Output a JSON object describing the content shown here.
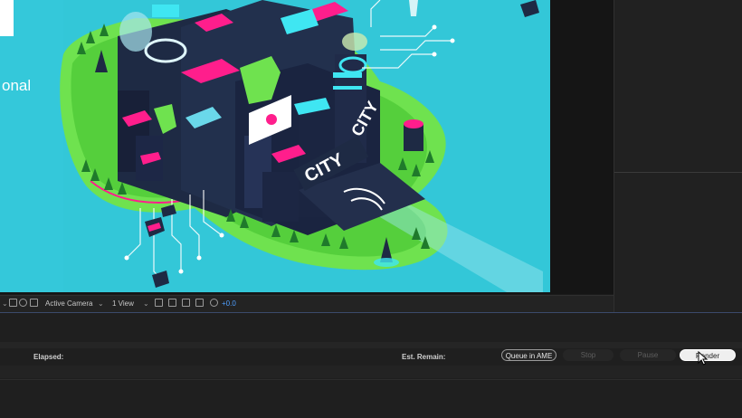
{
  "composition": {
    "left_text": "onal",
    "sign_text": "CITY",
    "sign_text_small": "CITY",
    "colors": {
      "background": "#33c7d8",
      "building": "#1e2a44",
      "accent": "#ff1e8c",
      "grass": "#6fe24f"
    }
  },
  "viewer_toolbar": {
    "camera_label": "Active Camera",
    "view_label": "1 View",
    "exposure_value": "+0.0",
    "icons": [
      "grid-icon",
      "mask-icon",
      "toggle-icon",
      "3d-layout-icon",
      "snapshot-icon",
      "transparency-icon",
      "exposure-icon"
    ]
  },
  "render_queue": {
    "elapsed_label": "Elapsed:",
    "est_remain_label": "Est. Remain:",
    "queue_ame_label": "Queue in AME",
    "stop_label": "Stop",
    "pause_label": "Pause",
    "render_label": "Render"
  }
}
